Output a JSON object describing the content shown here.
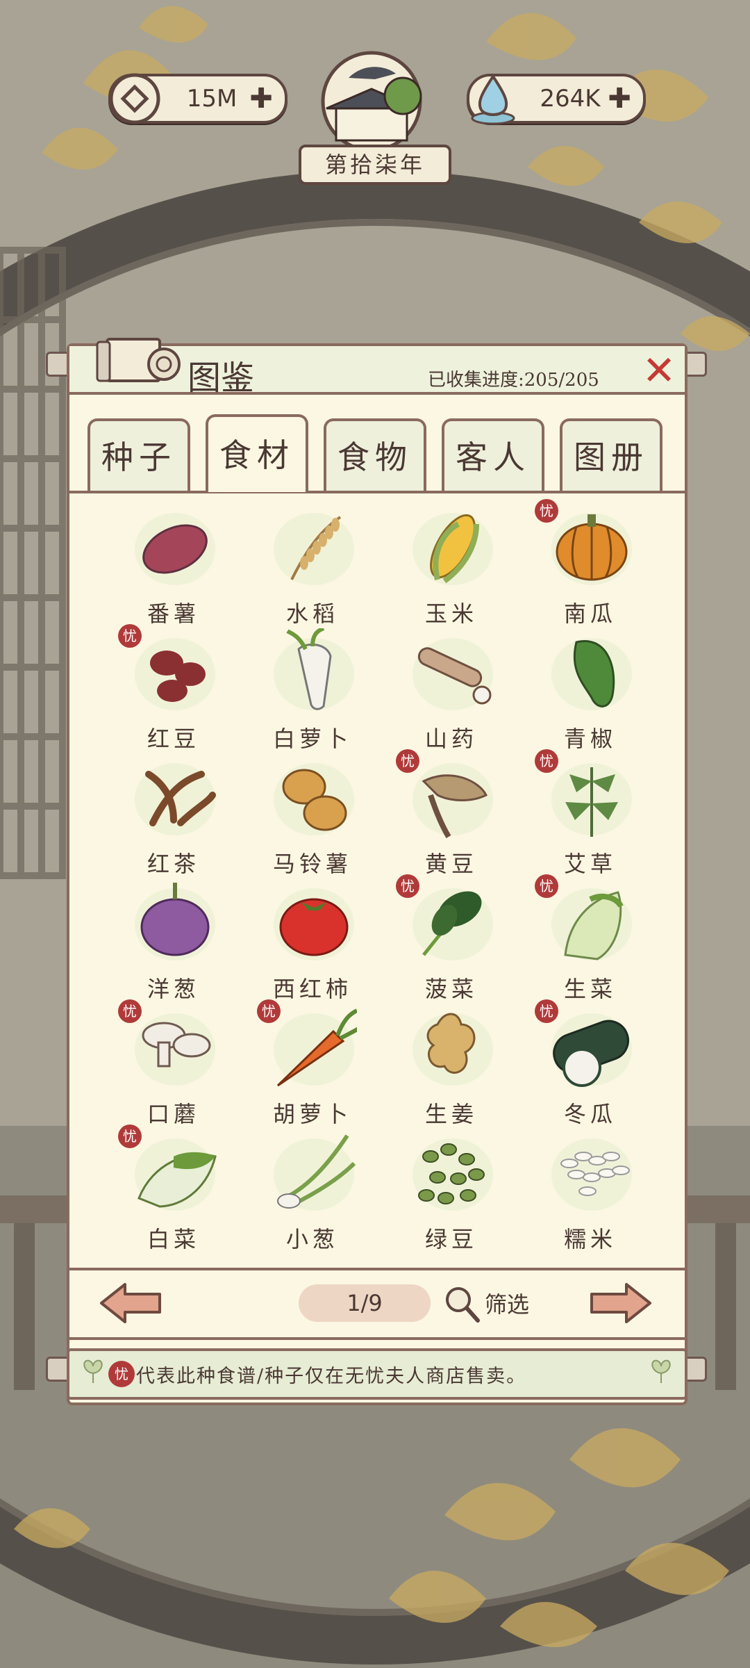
{
  "hud": {
    "coins": "15M",
    "essence": "264K",
    "year": "第拾柒年",
    "plus": "✚"
  },
  "panel": {
    "title": "图鉴",
    "progress": "已收集进度:205/205",
    "close": "✕"
  },
  "tabs": [
    {
      "label": "种子",
      "active": false
    },
    {
      "label": "食材",
      "active": true
    },
    {
      "label": "食物",
      "active": false
    },
    {
      "label": "客人",
      "active": false
    },
    {
      "label": "图册",
      "active": false
    }
  ],
  "items": [
    {
      "name": "番薯",
      "badge": false,
      "icon": "sweet-potato"
    },
    {
      "name": "水稻",
      "badge": false,
      "icon": "rice"
    },
    {
      "name": "玉米",
      "badge": false,
      "icon": "corn"
    },
    {
      "name": "南瓜",
      "badge": true,
      "icon": "pumpkin"
    },
    {
      "name": "红豆",
      "badge": true,
      "icon": "red-bean"
    },
    {
      "name": "白萝卜",
      "badge": false,
      "icon": "white-radish"
    },
    {
      "name": "山药",
      "badge": false,
      "icon": "yam"
    },
    {
      "name": "青椒",
      "badge": false,
      "icon": "green-pepper"
    },
    {
      "name": "红茶",
      "badge": false,
      "icon": "black-tea"
    },
    {
      "name": "马铃薯",
      "badge": false,
      "icon": "potato"
    },
    {
      "name": "黄豆",
      "badge": true,
      "icon": "soybean"
    },
    {
      "name": "艾草",
      "badge": true,
      "icon": "mugwort"
    },
    {
      "name": "洋葱",
      "badge": false,
      "icon": "onion"
    },
    {
      "name": "西红柿",
      "badge": false,
      "icon": "tomato"
    },
    {
      "name": "菠菜",
      "badge": true,
      "icon": "spinach"
    },
    {
      "name": "生菜",
      "badge": true,
      "icon": "lettuce"
    },
    {
      "name": "口蘑",
      "badge": true,
      "icon": "mushroom"
    },
    {
      "name": "胡萝卜",
      "badge": true,
      "icon": "carrot"
    },
    {
      "name": "生姜",
      "badge": false,
      "icon": "ginger"
    },
    {
      "name": "冬瓜",
      "badge": true,
      "icon": "winter-melon"
    },
    {
      "name": "白菜",
      "badge": true,
      "icon": "cabbage"
    },
    {
      "name": "小葱",
      "badge": false,
      "icon": "scallion"
    },
    {
      "name": "绿豆",
      "badge": false,
      "icon": "mung-bean"
    },
    {
      "name": "糯米",
      "badge": false,
      "icon": "glutinous-rice"
    }
  ],
  "badge_char": "忧",
  "pager": {
    "page": "1/9",
    "filter": "筛选"
  },
  "note": {
    "badge": "忧",
    "text": "代表此种食谱/种子仅在无忧夫人商店售卖。"
  },
  "colors": {
    "frame": "#8a6a5e",
    "paper": "#fbf7e2",
    "badge": "#b03a3a",
    "close": "#c43a35",
    "text": "#4a3833"
  }
}
